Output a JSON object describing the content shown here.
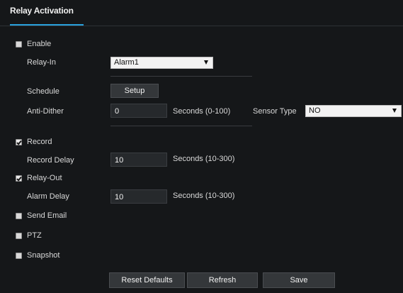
{
  "tab": {
    "title": "Relay Activation"
  },
  "enable": {
    "label": "Enable",
    "checked": false
  },
  "relay_in": {
    "label": "Relay-In",
    "value": "Alarm1"
  },
  "schedule": {
    "label": "Schedule",
    "button": "Setup"
  },
  "anti_dither": {
    "label": "Anti-Dither",
    "value": "0",
    "unit": "Seconds (0-100)"
  },
  "sensor_type": {
    "label": "Sensor Type",
    "value": "NO"
  },
  "record": {
    "label": "Record",
    "checked": true
  },
  "record_delay": {
    "label": "Record Delay",
    "value": "10",
    "unit": "Seconds (10-300)"
  },
  "relay_out": {
    "label": "Relay-Out",
    "checked": true
  },
  "alarm_delay": {
    "label": "Alarm Delay",
    "value": "10",
    "unit": "Seconds (10-300)"
  },
  "send_email": {
    "label": "Send Email",
    "checked": false
  },
  "ptz": {
    "label": "PTZ",
    "checked": false
  },
  "snapshot": {
    "label": "Snapshot",
    "checked": false
  },
  "buttons": {
    "reset": "Reset Defaults",
    "refresh": "Refresh",
    "save": "Save"
  },
  "colors": {
    "accent": "#29a1dc",
    "background": "#151719"
  }
}
